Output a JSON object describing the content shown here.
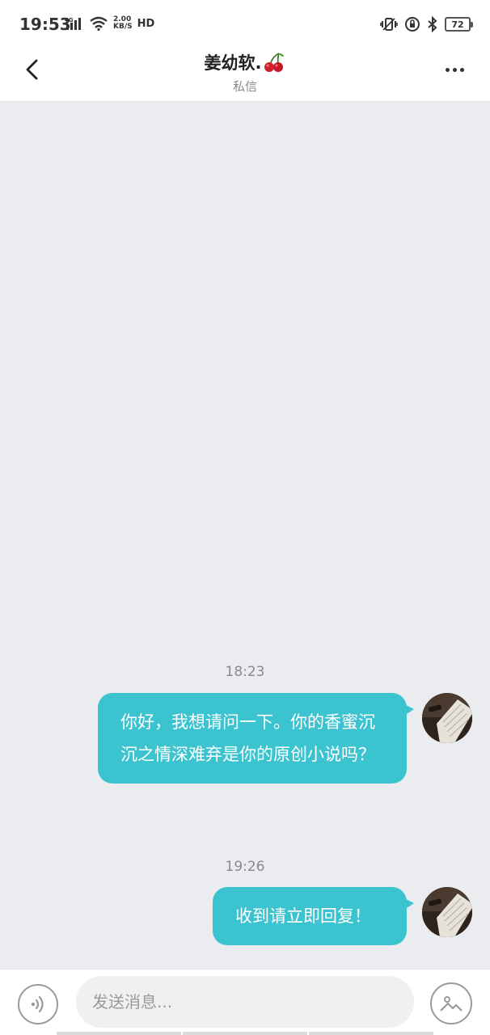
{
  "status_bar": {
    "time": "19:53",
    "network": "4G",
    "speed_value": "2.00",
    "speed_unit": "KB/S",
    "hd": "HD",
    "battery": "72"
  },
  "header": {
    "title": "姜幼软.",
    "title_emoji": "🍒",
    "subtitle": "私信",
    "back_icon": "chevron-left-icon",
    "more_icon": "more-dots-icon"
  },
  "messages": [
    {
      "time": "18:23",
      "text": "你好，我想请问一下。你的香蜜沉沉之情深难弃是你的原创小说吗？",
      "sender": "self"
    },
    {
      "time": "19:26",
      "text": "收到请立即回复！",
      "sender": "self"
    }
  ],
  "input_bar": {
    "placeholder": "发送消息...",
    "voice_icon": "voice-icon",
    "image_icon": "image-icon"
  },
  "colors": {
    "bubble": "#3bc3d0",
    "background": "#ebecf0",
    "header": "#ffffff"
  }
}
